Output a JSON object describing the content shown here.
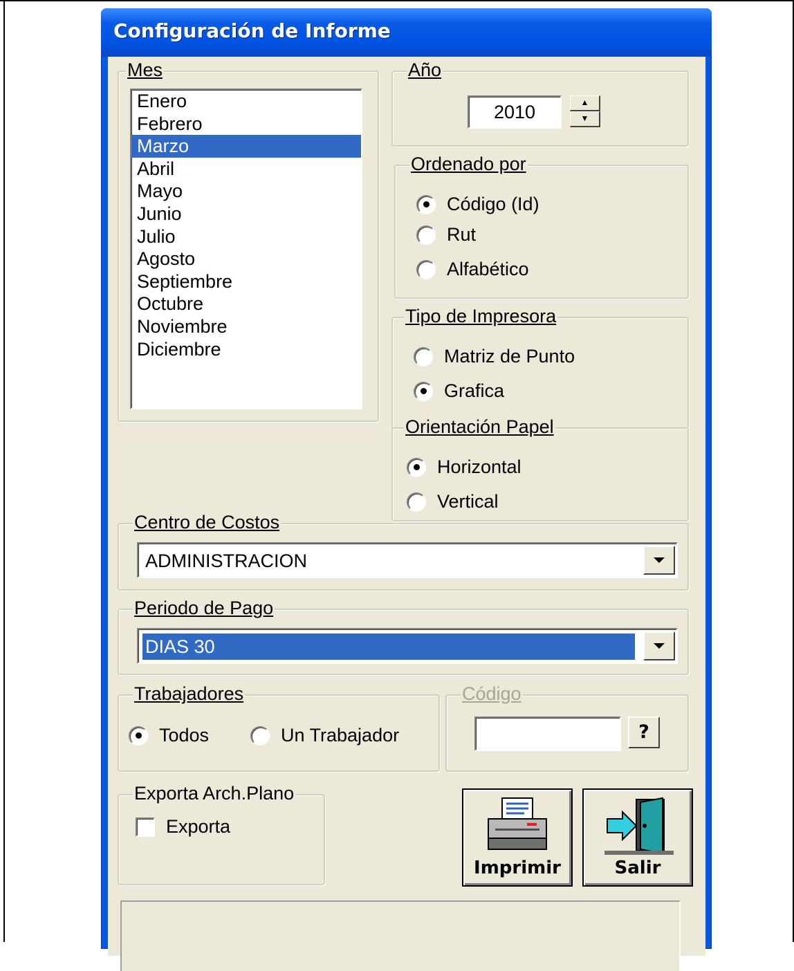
{
  "window": {
    "title": "Configuración de Informe"
  },
  "mes": {
    "legend": "Mes",
    "months": [
      "Enero",
      "Febrero",
      "Marzo",
      "Abril",
      "Mayo",
      "Junio",
      "Julio",
      "Agosto",
      "Septiembre",
      "Octubre",
      "Noviembre",
      "Diciembre"
    ],
    "selected": "Marzo"
  },
  "anio": {
    "legend": "Año",
    "value": "2010"
  },
  "ordenado": {
    "legend": "Ordenado por",
    "options": [
      "Código (Id)",
      "Rut",
      "Alfabético"
    ],
    "selected": "Código (Id)"
  },
  "impresora": {
    "legend": "Tipo de Impresora",
    "options": [
      "Matriz de Punto",
      "Grafica"
    ],
    "selected": "Grafica"
  },
  "orientacion": {
    "legend": "Orientación Papel",
    "options": [
      "Horizontal",
      "Vertical"
    ],
    "selected": "Horizontal"
  },
  "centro": {
    "legend": "Centro de Costos",
    "value": "ADMINISTRACION"
  },
  "periodo": {
    "legend": "Periodo de Pago",
    "value": "DIAS 30"
  },
  "trabajadores": {
    "legend": "Trabajadores",
    "options": [
      "Todos",
      "Un Trabajador"
    ],
    "selected": "Todos"
  },
  "codigo": {
    "legend": "Código",
    "value": "",
    "help_label": "?"
  },
  "exporta": {
    "legend": "Exporta Arch.Plano",
    "checkbox_label": "Exporta",
    "checked": false
  },
  "buttons": {
    "print_label": "Imprimir",
    "exit_label": "Salir"
  },
  "colors": {
    "title_bar": "#0054e3",
    "dialog_bg": "#ece9d8",
    "selection": "#316ac5"
  }
}
